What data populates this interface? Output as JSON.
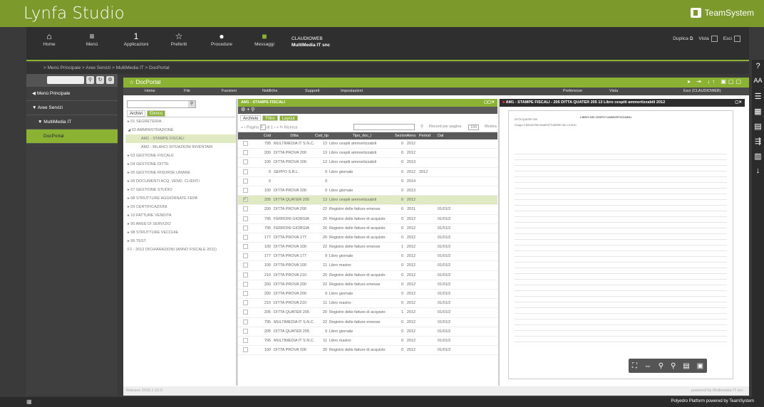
{
  "app": {
    "title": "Lynfa Studio",
    "brand": "TeamSystem"
  },
  "nav": {
    "items": [
      {
        "icon": "⌂",
        "label": "Home"
      },
      {
        "icon": "≡",
        "label": "Menù"
      },
      {
        "icon": "1",
        "label": "Applicazioni"
      },
      {
        "icon": "☆",
        "label": "Preferiti"
      },
      {
        "icon": "●",
        "label": "Procedure"
      },
      {
        "icon": "■",
        "label": "Messaggi"
      }
    ],
    "user_line1": "CLAUDIOWEB",
    "user_line2": "MultiMedia IT snc",
    "duplica": "Duplica",
    "vista": "Vista",
    "esci": "Esci"
  },
  "breadcrumb": "> Menù Principale > Aree Servizi > MultiMedia IT > DocPortal",
  "left": {
    "items": [
      "Menù Principale",
      "Aree Servizi",
      "MultiMedia IT",
      "DocPortal"
    ]
  },
  "doc": {
    "title": "DocPortal",
    "menu": [
      "Home",
      "File",
      "Funzioni",
      "Notifiche",
      "Supporti",
      "Impostazioni"
    ],
    "pref": "Preferenze",
    "vista": "Vista",
    "esci": "Esci (CLAUDIOWEB)"
  },
  "tree": {
    "tab_archive": "Archivi",
    "tab_elenco": "Elenco",
    "items": [
      "01 SEGRETERIA",
      "02 AMMINISTRAZIONE",
      "AM1 - STAMPE FISCALI",
      "AM2 - BILANCI SITUAZIONI INVENTARI",
      "03 GESTIONE FISCALE",
      "04 GESTIONE DITTE",
      "05 GESTIONE RISORSE UMANE",
      "06 DOCUMENTI ACQ. VEND. CLIENTI",
      "07 GESTIONE STUDIO",
      "08 STRUTTURE AGGIORNATE FEPA",
      "09 CERTIFICAZIONI",
      "10 FATTURE VENDITA",
      "90 AREE DI SERVIZIO",
      "98 STRUTTURE VECCHIE",
      "99 TEST",
      "F1 - 2012 DICHIARAZIONI (ANNO FISCALE 2011)"
    ]
  },
  "grid": {
    "title": "AM1 - STAMPE FISCALI",
    "tabs": [
      "Archivio",
      "Filtro",
      "Layout"
    ],
    "pager": "Pagina",
    "pagenum": "1",
    "of": "di 1",
    "ricerca": "Ricerca",
    "records": "Record per pagina",
    "recnum": "100",
    "mostra": "Mostra",
    "headers": [
      "",
      "Cod",
      "Ditta",
      "Cod_tip",
      "Tipo_doc_l",
      "Sezion",
      "Anno",
      "Period",
      "Dal"
    ],
    "rows": [
      [
        "",
        "795",
        "MULTIMEDIA IT S.N.C. DI ROMAGNOL",
        "13",
        "Libro cespiti ammortizzabili",
        "0",
        "2012",
        "",
        ""
      ],
      [
        "",
        "200",
        "DITTA PROVA 200",
        "13",
        "Libro cespiti ammortizzabili",
        "0",
        "2012",
        "",
        ""
      ],
      [
        "",
        "100",
        "DITTA PROVA 100",
        "13",
        "Libro cespiti ammortizzabili",
        "0",
        "2013",
        "",
        ""
      ],
      [
        "",
        "0",
        "SEPPO S.R.L.",
        "9",
        "Libro giornale",
        "0",
        "2012",
        "2012",
        ""
      ],
      [
        "",
        "0",
        "",
        "0",
        "",
        "0",
        "2014",
        "",
        ""
      ],
      [
        "",
        "100",
        "DITTA PROVA 100",
        "9",
        "Libro giornale",
        "0",
        "2013",
        "",
        ""
      ],
      [
        "✓",
        "205",
        "DITTA QUATER 205",
        "13",
        "Libro cespiti ammortizzabili",
        "0",
        "2012",
        "",
        ""
      ],
      [
        "",
        "200",
        "DITTA PROVA 200",
        "22",
        "Registro delle fatture emesse",
        "0",
        "2011",
        "",
        "01/01/2"
      ],
      [
        "",
        "795",
        "FERRONI GIORGIA",
        "20",
        "Registro delle fatture di acquisto",
        "0",
        "2012",
        "",
        "01/01/2"
      ],
      [
        "",
        "795",
        "FERRONI GIORGIA",
        "20",
        "Registro delle fatture di acquisto",
        "0",
        "2012",
        "",
        "01/01/2"
      ],
      [
        "",
        "177",
        "DITTA PROVA 177",
        "20",
        "Registro delle fatture di acquisto",
        "0",
        "2012",
        "",
        "01/01/2"
      ],
      [
        "",
        "100",
        "DITTA PROVA 100",
        "22",
        "Registro delle fatture emesse",
        "1",
        "2012",
        "",
        "01/01/2"
      ],
      [
        "",
        "177",
        "DITTA PROVA 177",
        "9",
        "Libro giornale",
        "0",
        "2012",
        "",
        "01/01/2"
      ],
      [
        "",
        "100",
        "DITTA PROVA 100",
        "11",
        "Libro mastro",
        "0",
        "2012",
        "",
        "01/01/2"
      ],
      [
        "",
        "210",
        "DITTA PROVA 210",
        "20",
        "Registro delle fatture di acquisto",
        "0",
        "2012",
        "",
        "01/01/2"
      ],
      [
        "",
        "200",
        "DITTA PROVA 200",
        "22",
        "Registro delle fatture emesse",
        "0",
        "2012",
        "",
        "01/01/2"
      ],
      [
        "",
        "200",
        "DITTA PROVA 200",
        "9",
        "Libro giornale",
        "0",
        "2012",
        "",
        "01/01/2"
      ],
      [
        "",
        "210",
        "DITTA PROVA 210",
        "11",
        "Libro mastro",
        "0",
        "2012",
        "",
        "01/01/2"
      ],
      [
        "",
        "205",
        "DITTA QUATER 205",
        "20",
        "Registro delle fatture di acquisto",
        "1",
        "2012",
        "",
        "01/01/2"
      ],
      [
        "",
        "795",
        "MULTIMEDIA IT S.N.C. DI ROMAGNOL",
        "22",
        "Registro delle fatture emesse",
        "0",
        "2012",
        "",
        "01/01/2"
      ],
      [
        "",
        "205",
        "DITTA QUATER 205",
        "9",
        "Libro giornale",
        "0",
        "2012",
        "",
        "01/01/2"
      ],
      [
        "",
        "795",
        "MULTIMEDIA IT S.N.C. DI ROMAGNOL",
        "11",
        "Libro mastro",
        "0",
        "2012",
        "",
        "01/01/2"
      ],
      [
        "",
        "100",
        "DITTA PROVA 100",
        "20",
        "Registro delle fatture di acquisto",
        "0",
        "2012",
        "",
        "01/01/2"
      ]
    ]
  },
  "preview": {
    "title": "AM1 - STAMPE FISCALI - 205 DITTA QUATER 205 13 Libro cespiti ammortizzabili 2012",
    "doc_heading": "LIBRO DEI CESPITI AMMORTIZZABILI",
    "doc_company": "DITTA QUATER 205",
    "doc_group": "Gruppo  9  INDUSTRIE MANIFATTURIERE DEL LEGNO"
  },
  "status": {
    "left": "Release 2016.1 10.0",
    "right": "powered by Multimedia IT snc"
  },
  "footer": {
    "right": "Polyedro Platform powered by TeamSystem"
  }
}
